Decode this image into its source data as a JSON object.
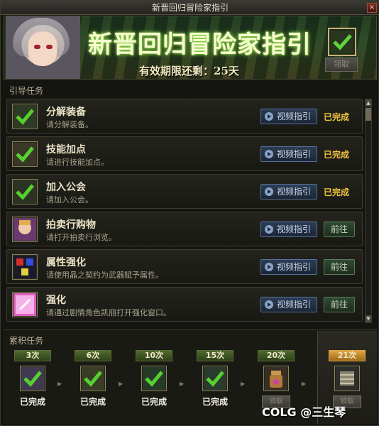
{
  "window": {
    "title": "新晋回归冒险家指引",
    "close_label": "×"
  },
  "banner": {
    "title": "新晋回归冒险家指引",
    "validity": "有效期限还剩：25天",
    "claim_label": "领取"
  },
  "guide": {
    "label": "引导任务",
    "tasks": [
      {
        "name": "分解装备",
        "desc": "请分解装备。",
        "video": "视频指引",
        "status": "已完成",
        "action": "",
        "icon": "check-icon"
      },
      {
        "name": "技能加点",
        "desc": "请进行技能加点。",
        "video": "视频指引",
        "status": "已完成",
        "action": "",
        "icon": "check-icon"
      },
      {
        "name": "加入公会",
        "desc": "请加入公会。",
        "video": "视频指引",
        "status": "已完成",
        "action": "",
        "icon": "check-icon"
      },
      {
        "name": "拍卖行购物",
        "desc": "请打开拍卖行浏览。",
        "video": "视频指引",
        "status": "",
        "action": "前往",
        "icon": "auction-icon"
      },
      {
        "name": "属性强化",
        "desc": "请使用晶之契约为武器赋予属性。",
        "video": "视频指引",
        "status": "",
        "action": "前往",
        "icon": "crystal-icon"
      },
      {
        "name": "强化",
        "desc": "请通过剧情角色凯丽打开强化窗口。",
        "video": "视频指引",
        "status": "",
        "action": "前往",
        "icon": "enhance-icon"
      }
    ]
  },
  "cumulative": {
    "label": "累积任务",
    "milestones": [
      {
        "count": "3次",
        "status": "已完成",
        "claim": ""
      },
      {
        "count": "6次",
        "status": "已完成",
        "claim": ""
      },
      {
        "count": "10次",
        "status": "已完成",
        "claim": ""
      },
      {
        "count": "15次",
        "status": "已完成",
        "claim": ""
      },
      {
        "count": "20次",
        "status": "",
        "claim": "领取"
      },
      {
        "count": "21次",
        "status": "",
        "claim": "领取"
      }
    ]
  },
  "watermark": "COLG @三生琴",
  "colors": {
    "done": "#f0c340",
    "accent_green": "#9eea5a",
    "gold_tab": "#e0a640"
  }
}
